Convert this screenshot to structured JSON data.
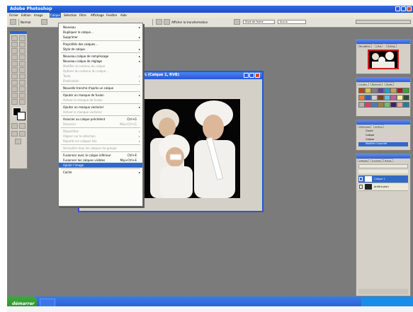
{
  "window": {
    "title": "Adobe Photoshop"
  },
  "menubar": {
    "items": [
      {
        "label": "Fichier",
        "active": false
      },
      {
        "label": "Edition",
        "active": false
      },
      {
        "label": "Image",
        "active": false
      },
      {
        "label": "Calque",
        "active": true
      },
      {
        "label": "Sélection",
        "active": false
      },
      {
        "label": "Filtre",
        "active": false
      },
      {
        "label": "Affichage",
        "active": false
      },
      {
        "label": "Fenêtre",
        "active": false
      },
      {
        "label": "Aide",
        "active": false
      }
    ]
  },
  "options_bar": {
    "mode_label": "Normal",
    "zoom_label": "Afficher la transformation",
    "style_label": "Style de forme",
    "field_label": "Aucun"
  },
  "document": {
    "title": "% (Calque 1, RVB)"
  },
  "layer_menu": {
    "items": [
      {
        "label": "Nouveau",
        "shortcut": "",
        "submenu": true,
        "disabled": false
      },
      {
        "label": "Dupliquer le calque...",
        "shortcut": "",
        "submenu": false,
        "disabled": false
      },
      {
        "label": "Supprimer",
        "shortcut": "",
        "submenu": true,
        "disabled": false
      },
      {
        "sep": true
      },
      {
        "label": "Propriétés des calques...",
        "shortcut": "",
        "submenu": false,
        "disabled": false
      },
      {
        "label": "Style de calque",
        "shortcut": "",
        "submenu": true,
        "disabled": false
      },
      {
        "sep": true
      },
      {
        "label": "Nouveau calque de remplissage",
        "shortcut": "",
        "submenu": true,
        "disabled": false
      },
      {
        "label": "Nouveau calque de réglage",
        "shortcut": "",
        "submenu": true,
        "disabled": false
      },
      {
        "label": "Modifier le contenu du calque",
        "shortcut": "",
        "submenu": false,
        "disabled": true
      },
      {
        "label": "Options du contenu du calque...",
        "shortcut": "",
        "submenu": false,
        "disabled": true
      },
      {
        "label": "Texte",
        "shortcut": "",
        "submenu": true,
        "disabled": true
      },
      {
        "label": "Pixelisation",
        "shortcut": "",
        "submenu": true,
        "disabled": true
      },
      {
        "sep": true
      },
      {
        "label": "Nouvelle tranche d'après un calque",
        "shortcut": "",
        "submenu": false,
        "disabled": false
      },
      {
        "sep": true
      },
      {
        "label": "Ajouter un masque de fusion",
        "shortcut": "",
        "submenu": true,
        "disabled": false
      },
      {
        "label": "Activer le masque de fusion",
        "shortcut": "",
        "submenu": false,
        "disabled": true
      },
      {
        "sep": true
      },
      {
        "label": "Ajouter un masque vectoriel",
        "shortcut": "",
        "submenu": true,
        "disabled": false
      },
      {
        "label": "Activer le masque vectoriel",
        "shortcut": "",
        "submenu": false,
        "disabled": true
      },
      {
        "sep": true
      },
      {
        "label": "Associer au calque précédent",
        "shortcut": "Ctrl+G",
        "submenu": false,
        "disabled": false
      },
      {
        "label": "Dissocier",
        "shortcut": "Maj+Ctrl+G",
        "submenu": false,
        "disabled": true
      },
      {
        "sep": true
      },
      {
        "label": "Disposition",
        "shortcut": "",
        "submenu": true,
        "disabled": true
      },
      {
        "label": "Aligner sur la sélection",
        "shortcut": "",
        "submenu": true,
        "disabled": true
      },
      {
        "label": "Répartir les calques liés",
        "shortcut": "",
        "submenu": true,
        "disabled": true
      },
      {
        "sep": true
      },
      {
        "label": "Verrouiller tous les calques du groupe",
        "shortcut": "",
        "submenu": false,
        "disabled": true
      },
      {
        "sep": true
      },
      {
        "label": "Fusionner avec le calque inférieur",
        "shortcut": "Ctrl+E",
        "submenu": false,
        "disabled": false
      },
      {
        "label": "Fusionner les calques visibles",
        "shortcut": "Maj+Ctrl+E",
        "submenu": false,
        "disabled": false
      },
      {
        "label": "Aplatir l'image",
        "shortcut": "",
        "submenu": false,
        "disabled": false,
        "highlighted": true
      },
      {
        "sep": true
      },
      {
        "label": "Cache",
        "shortcut": "",
        "submenu": true,
        "disabled": false
      }
    ]
  },
  "right_panels": {
    "navigator_tabs": [
      "Navigation",
      "Infos",
      "Histogr."
    ],
    "styles_tabs": [
      "Couleur",
      "Nuancier",
      "Styles"
    ],
    "history_tabs": [
      "Historique",
      "Actions"
    ],
    "history_items": [
      "Ouvrir",
      "Calque",
      "Calque"
    ],
    "history_selected": "Modifier l'opacité",
    "layers_tabs": [
      "Calques",
      "Couches",
      "Tracés"
    ],
    "layers": [
      {
        "name": "Calque 1",
        "selected": true
      },
      {
        "name": "Arrière-plan",
        "selected": false
      }
    ]
  },
  "taskbar": {
    "start_label": "démarrer"
  },
  "colors": {
    "title_blue": "#1a4fc6",
    "highlight": "#316ac5",
    "workspace": "#7b7b7b"
  }
}
